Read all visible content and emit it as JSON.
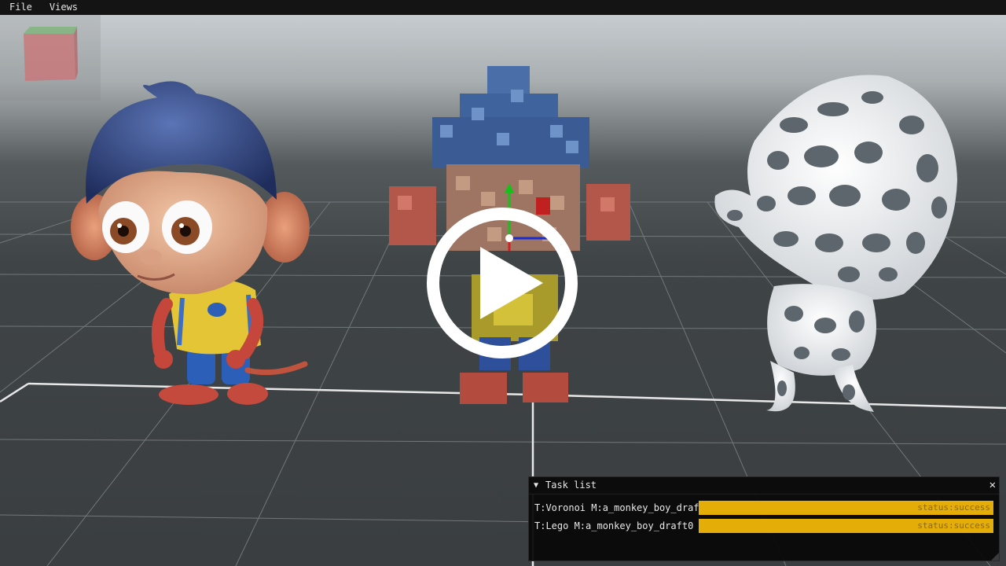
{
  "menubar": {
    "items": [
      {
        "label": "File"
      },
      {
        "label": "Views"
      }
    ]
  },
  "viewport": {
    "background_top": "#c9ced0",
    "floor_color": "#3d4244",
    "grid_line_color": "#ffffff",
    "models": [
      {
        "name": "original-monkey-boy"
      },
      {
        "name": "lego-monkey-boy"
      },
      {
        "name": "voronoi-monkey-boy"
      }
    ],
    "overlay": {
      "icon": "play-icon"
    }
  },
  "task_list": {
    "title": "Task list",
    "collapse_icon": "▼",
    "close_icon": "✕",
    "tasks": [
      {
        "label": "T:Voronoi M:a_monkey_boy_draf",
        "status": "status:success",
        "progress": 1.0
      },
      {
        "label": "T:Lego M:a_monkey_boy_draft0",
        "status": "status:success",
        "progress": 1.0
      }
    ],
    "accent": "#e5ad08"
  }
}
